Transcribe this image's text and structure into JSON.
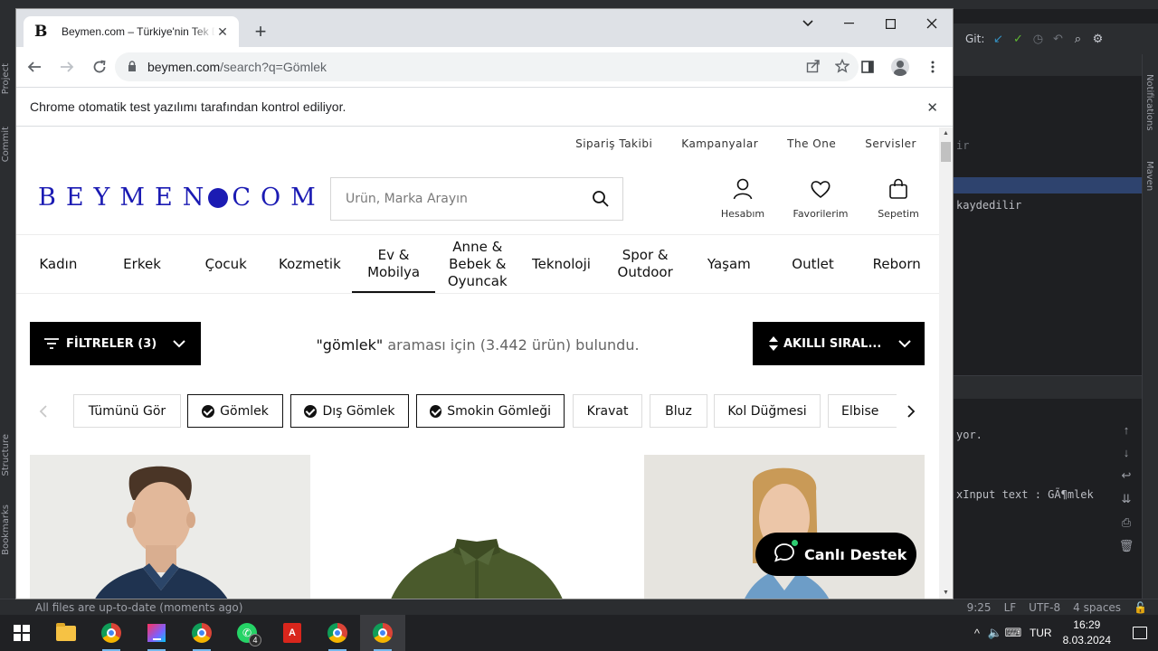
{
  "ide": {
    "toolbar": {
      "git_label": "Git:"
    },
    "code_lines": [
      "ir",
      "kaydedilir"
    ],
    "console_lines": [
      "yor.",
      "xInput text : GÃ¶mlek"
    ],
    "side_labels_left": [
      "Project",
      "Commit",
      "Structure",
      "Bookmarks"
    ],
    "side_labels_right": [
      "Notifications",
      "Maven"
    ],
    "statusbar": {
      "message": "All files are up-to-date (moments ago)",
      "position": "9:25",
      "line_sep": "LF",
      "encoding": "UTF-8",
      "indent": "4 spaces"
    }
  },
  "taskbar": {
    "apps": [
      {
        "name": "file-explorer"
      },
      {
        "name": "chrome"
      },
      {
        "name": "intellij"
      },
      {
        "name": "chrome"
      },
      {
        "name": "whatsapp",
        "badge": "4"
      },
      {
        "name": "acrobat"
      },
      {
        "name": "chrome"
      },
      {
        "name": "chrome",
        "active": true
      }
    ],
    "tray": {
      "language": "TUR",
      "time": "16:29",
      "date": "8.03.2024"
    }
  },
  "browser": {
    "tab": {
      "favicon": "B",
      "title": "Beymen.com – Türkiye'nin Tek Dijital Lüks"
    },
    "url": {
      "host": "beymen.com",
      "path": "/search?q=Gömlek"
    },
    "infobar": "Chrome otomatik test yazılımı tarafından kontrol ediliyor."
  },
  "page": {
    "util_links": [
      "Sipariş Takibi",
      "Kampanyalar",
      "The One",
      "Servisler"
    ],
    "logo": {
      "left": "BEYMEN",
      "right": "COM"
    },
    "search": {
      "placeholder": "Ürün, Marka Arayın"
    },
    "header_actions": [
      {
        "label": "Hesabım",
        "icon": "user-icon"
      },
      {
        "label": "Favorilerim",
        "icon": "heart-icon"
      },
      {
        "label": "Sepetim",
        "icon": "bag-icon"
      }
    ],
    "categories": [
      {
        "label": "Kadın"
      },
      {
        "label": "Erkek"
      },
      {
        "label": "Çocuk"
      },
      {
        "label": "Kozmetik"
      },
      {
        "label": "Ev & Mobilya",
        "active": true
      },
      {
        "label": "Anne & Bebek & Oyuncak"
      },
      {
        "label": "Teknoloji"
      },
      {
        "label": "Spor & Outdoor"
      },
      {
        "label": "Yaşam"
      },
      {
        "label": "Outlet"
      },
      {
        "label": "Reborn"
      }
    ],
    "filter_button": "FİLTRELER (3)",
    "result": {
      "query": "\"gömlek\"",
      "text": " araması için (3.442 ürün) bulundu."
    },
    "sort_button": "AKILLI SIRAL...",
    "chips": [
      {
        "label": "Tümünü Gör",
        "selected": false
      },
      {
        "label": "Gömlek",
        "selected": true
      },
      {
        "label": "Dış Gömlek",
        "selected": true
      },
      {
        "label": "Smokin Gömleği",
        "selected": true
      },
      {
        "label": "Kravat",
        "selected": false
      },
      {
        "label": "Bluz",
        "selected": false
      },
      {
        "label": "Kol Düğmesi",
        "selected": false
      },
      {
        "label": "Elbise",
        "selected": false
      }
    ],
    "live_chat": "Canlı Destek",
    "colors": {
      "brand": "#1b1bb3",
      "black": "#000000",
      "olive_shirt": "#4a5a2c",
      "navy_shirt": "#1f3350",
      "denim_shirt": "#6d9dc7"
    }
  }
}
